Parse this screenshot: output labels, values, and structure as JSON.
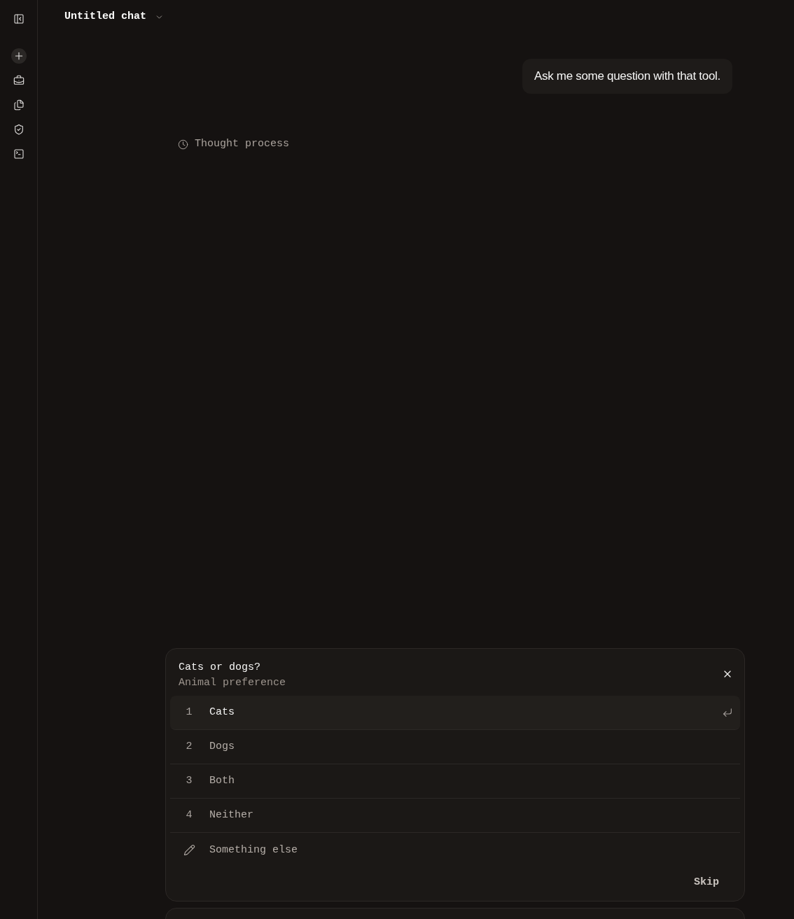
{
  "header": {
    "title": "Untitled chat"
  },
  "messages": [
    {
      "kind": "user",
      "text": "Ask me some question with that tool."
    },
    {
      "kind": "thought",
      "label": "Thought process"
    }
  ],
  "question": {
    "title": "Cats or dogs?",
    "subtitle": "Animal preference",
    "options": [
      {
        "kind": "choice",
        "number": "1",
        "label": "Cats",
        "selected": true
      },
      {
        "kind": "choice",
        "number": "2",
        "label": "Dogs",
        "selected": false
      },
      {
        "kind": "choice",
        "number": "3",
        "label": "Both",
        "selected": false
      },
      {
        "kind": "choice",
        "number": "4",
        "label": "Neither",
        "selected": false
      },
      {
        "kind": "custom",
        "label": "Something else",
        "selected": false
      }
    ],
    "skip_label": "Skip"
  }
}
